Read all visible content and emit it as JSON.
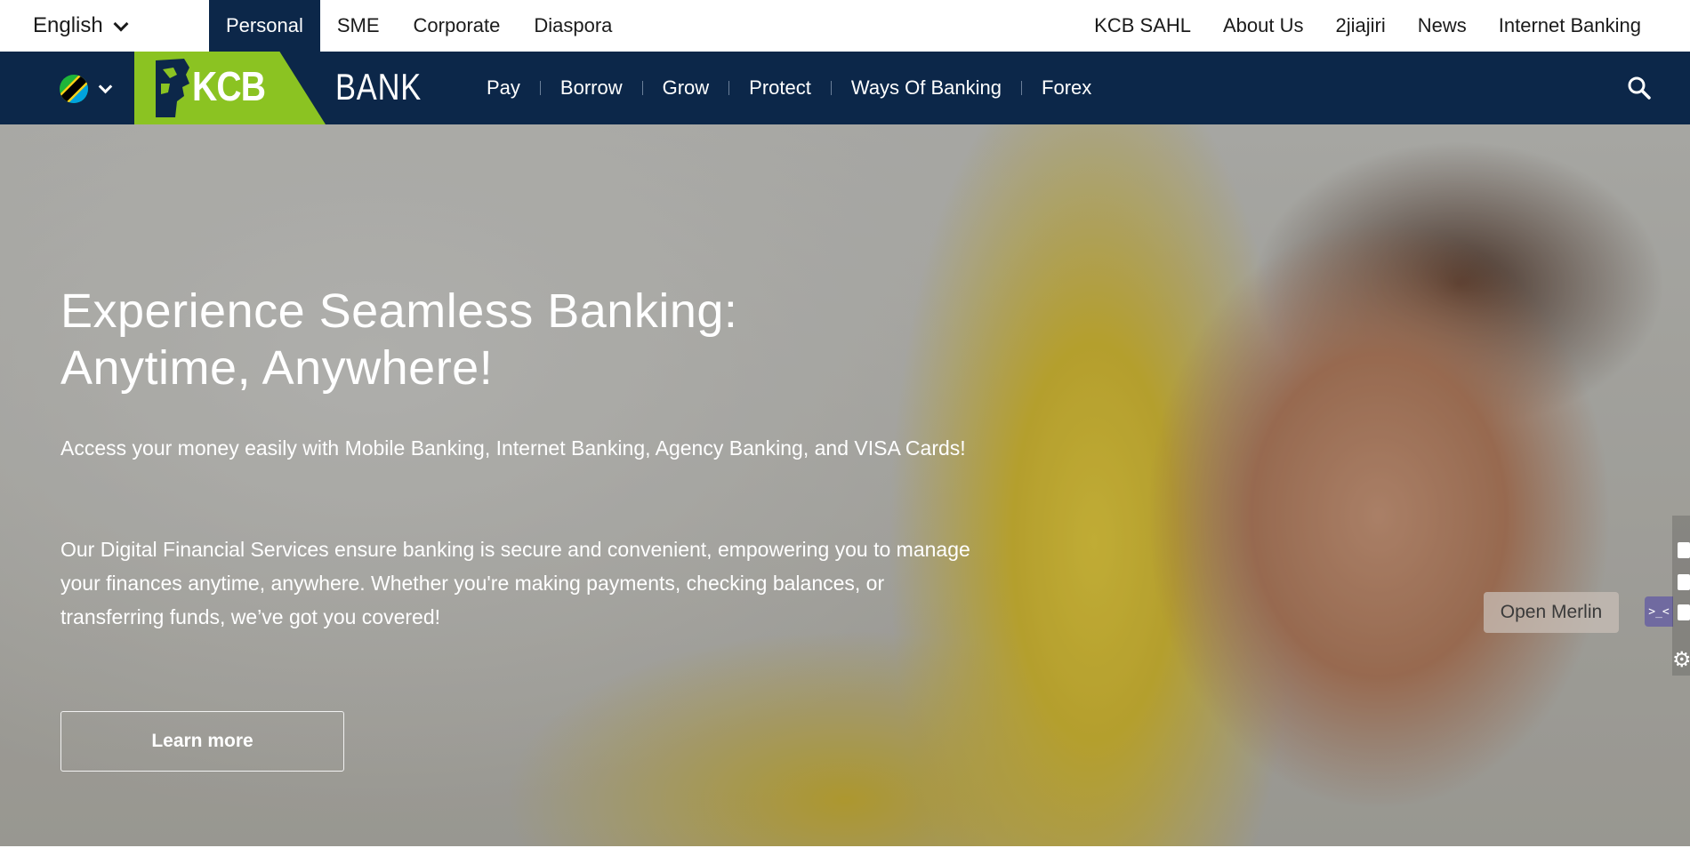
{
  "topbar": {
    "language": "English",
    "segments": [
      {
        "label": "Personal",
        "active": true
      },
      {
        "label": "SME",
        "active": false
      },
      {
        "label": "Corporate",
        "active": false
      },
      {
        "label": "Diaspora",
        "active": false
      }
    ],
    "utility_links": [
      "KCB SAHL",
      "About Us",
      "2jiajiri",
      "News",
      "Internet Banking"
    ]
  },
  "mainnav": {
    "country_flag": "tanzania-flag-icon",
    "logo_text": "KCB",
    "logo_suffix": "BANK",
    "items": [
      "Pay",
      "Borrow",
      "Grow",
      "Protect",
      "Ways Of Banking",
      "Forex"
    ],
    "search_icon": "search-icon"
  },
  "hero": {
    "title_line1": "Experience Seamless Banking:",
    "title_line2": "Anytime, Anywhere!",
    "paragraph1": "Access your money easily with Mobile Banking, Internet Banking, Agency Banking, and VISA Cards!",
    "paragraph2": "Our Digital Financial Services ensure banking is secure and convenient, empowering you to manage your finances anytime, anywhere. Whether you're making payments, checking balances, or transferring funds, we’ve got you covered!",
    "cta_label": "Learn more"
  },
  "overlay": {
    "merlin_label": "Open Merlin",
    "merlin_tab_glyph": ">_<"
  },
  "colors": {
    "navy": "#0c2749",
    "brand_green": "#8bc322",
    "white": "#ffffff"
  }
}
